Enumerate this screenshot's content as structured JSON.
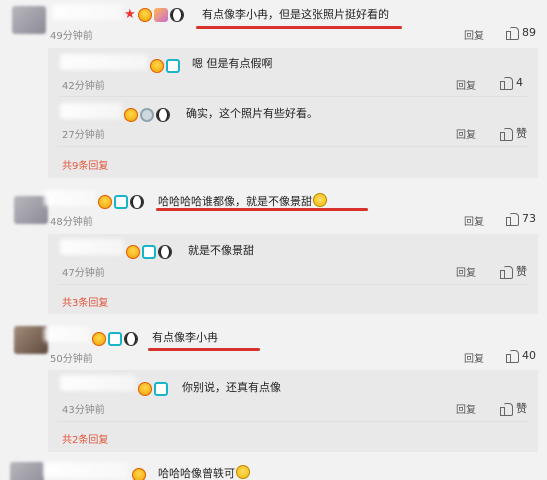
{
  "comments": [
    {
      "text": "有点像李小冉，但是这张照片挺好看的",
      "time": "49分钟前",
      "reply": "回复",
      "likes": "89",
      "subs": [
        {
          "text": "嗯 但是有点假啊",
          "time": "42分钟前",
          "reply": "回复",
          "likes": "4"
        },
        {
          "text": "确实，这个照片有些好看。",
          "time": "27分钟前",
          "reply": "回复",
          "likes": "赞"
        }
      ],
      "more": "共9条回复"
    },
    {
      "text": "哈哈哈哈谁都像，就是不像景甜",
      "time": "48分钟前",
      "reply": "回复",
      "likes": "73",
      "subs": [
        {
          "text": "就是不像景甜",
          "time": "47分钟前",
          "reply": "回复",
          "likes": "赞"
        }
      ],
      "more": "共3条回复"
    },
    {
      "text": "有点像李小冉",
      "time": "50分钟前",
      "reply": "回复",
      "likes": "40",
      "subs": [
        {
          "text": "你别说，还真有点像",
          "time": "43分钟前",
          "reply": "回复",
          "likes": "赞"
        }
      ],
      "more": "共2条回复"
    },
    {
      "text": "哈哈哈像曾轶可"
    }
  ],
  "colors": {
    "underline": "#d9322c",
    "link": "#e2553a"
  }
}
